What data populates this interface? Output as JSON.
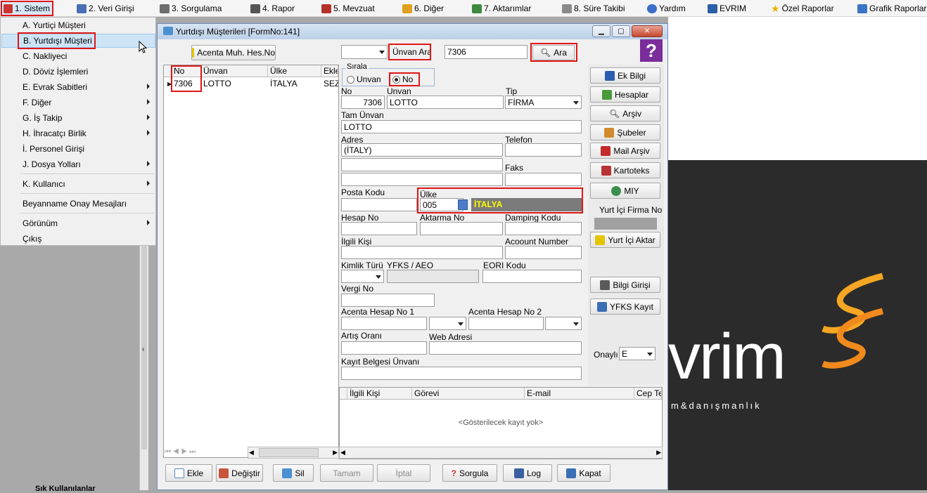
{
  "menubar": {
    "items": [
      {
        "label": "1.  Sistem"
      },
      {
        "label": "2.  Veri Girişi"
      },
      {
        "label": "3.  Sorgulama"
      },
      {
        "label": "4.  Rapor"
      },
      {
        "label": "5.  Mevzuat"
      },
      {
        "label": "6.  Diğer"
      },
      {
        "label": "7.  Aktarımlar"
      },
      {
        "label": "8. Süre Takibi"
      },
      {
        "label": "Yardım"
      },
      {
        "label": "EVRIM"
      },
      {
        "label": "Özel Raporlar"
      },
      {
        "label": "Grafik Raporlar"
      }
    ]
  },
  "sistem_menu": {
    "items": [
      {
        "label": "A.  Yurtiçi Müşteri"
      },
      {
        "label": "B.  Yurtdışı Müşteri"
      },
      {
        "label": "C.  Nakliyeci"
      },
      {
        "label": "D.  Döviz İşlemleri"
      },
      {
        "label": "E.  Evrak Sabitleri"
      },
      {
        "label": "F.  Diğer"
      },
      {
        "label": "G.  İş Takip"
      },
      {
        "label": "H.  İhracatçı Birlik"
      },
      {
        "label": "İ.   Personel Girişi"
      },
      {
        "label": "J.  Dosya Yolları"
      },
      {
        "label": "K.  Kullanıcı"
      },
      {
        "label": "Beyanname Onay Mesajları"
      },
      {
        "label": "Görünüm"
      },
      {
        "label": "Çıkış"
      }
    ]
  },
  "left_bottom_label": "Sık Kullanılanlar",
  "window": {
    "title": "Yurtdışı Müşterileri [FormNo:141]",
    "acenta_button": "Acenta Muh. Hes.No",
    "search_field_select": "Ünvan Ara",
    "search_value": "7306",
    "ara_button": "Ara",
    "help_glyph": "?",
    "grid": {
      "columns": [
        "No",
        "Ünvan",
        "Ülke",
        "Ekle"
      ],
      "rows": [
        {
          "no": "7306",
          "unvan": "LOTTO",
          "ulke": "İTALYA",
          "ekle": "SEZ"
        }
      ]
    },
    "sirala": {
      "label": "Sırala",
      "option_unvan": "Unvan",
      "option_no": "No",
      "selected": "No"
    },
    "form": {
      "no_label": "No",
      "no_value": "7306",
      "unvan_label": "Unvan",
      "unvan_value": "LOTTO",
      "tip_label": "Tip",
      "tip_value": "FİRMA",
      "tam_unvan_label": "Tam Ünvan",
      "tam_unvan_value": "LOTTO",
      "adres_label": "Adres",
      "adres_value": " (İTALY)",
      "telefon_label": "Telefon",
      "faks_label": "Faks",
      "posta_kodu_label": "Posta Kodu",
      "ulke_label": "Ülke",
      "ulke_code": "005",
      "ulke_name": "İTALYA",
      "hesap_no_label": "Hesap No",
      "aktarma_no_label": "Aktarma No",
      "damping_kodu_label": "Damping Kodu",
      "ilgili_kisi_label": "İlgili Kişi",
      "account_number_label": "Acoount Number",
      "kimlik_turu_label": "Kimlik Türü",
      "yfks_aeo_label": "YFKS / AEO",
      "eori_label": "EORI Kodu",
      "vergi_no_label": "Vergi No",
      "acenta_hesap1_label": "Acenta Hesap No 1",
      "acenta_hesap2_label": "Acenta Hesap No 2",
      "artis_orani_label": "Artış Oranı",
      "web_adresi_label": "Web Adresi",
      "kayit_belgesi_label": "Kayıt Belgesi Ünvanı"
    },
    "side_buttons": {
      "ek_bilgi": "Ek Bilgi",
      "hesaplar": "Hesaplar",
      "arsiv": "Arşiv",
      "subeler": "Şubeler",
      "mail_arsiv": "Mail Arşiv",
      "kartoteks": "Kartoteks",
      "miy": "MIY",
      "yurt_ici_firma_no": "Yurt İçi Firma No",
      "yurt_ici_aktar": "Yurt İçi Aktar",
      "bilgi_girisi": "Bilgi Girişi",
      "yfks_kayit": "YFKS Kayıt",
      "onayli_label": "Onaylı",
      "onayli_value": "E"
    },
    "contact_grid": {
      "columns": [
        "İlgili Kişi",
        "Görevi",
        "E-mail",
        "Cep Tel"
      ],
      "empty_text": "<Gösterilecek kayıt yok>"
    },
    "bottom_buttons": {
      "ekle": "Ekle",
      "degistir": "Değiştir",
      "sil": "Sil",
      "tamam": "Tamam",
      "iptal": "İptal",
      "sorgula": "Sorgula",
      "log": "Log",
      "kapat": "Kapat"
    }
  },
  "brand": {
    "wordmark": "vrim",
    "tagline": "m&danışmanlık"
  },
  "colors": {
    "highlight_red": "#e01616",
    "selected_menu_bg": "#cde4f7",
    "country_bar_bg": "#7b7b7b",
    "country_text": "#ffff00",
    "brand_orange": "#f5a623"
  }
}
